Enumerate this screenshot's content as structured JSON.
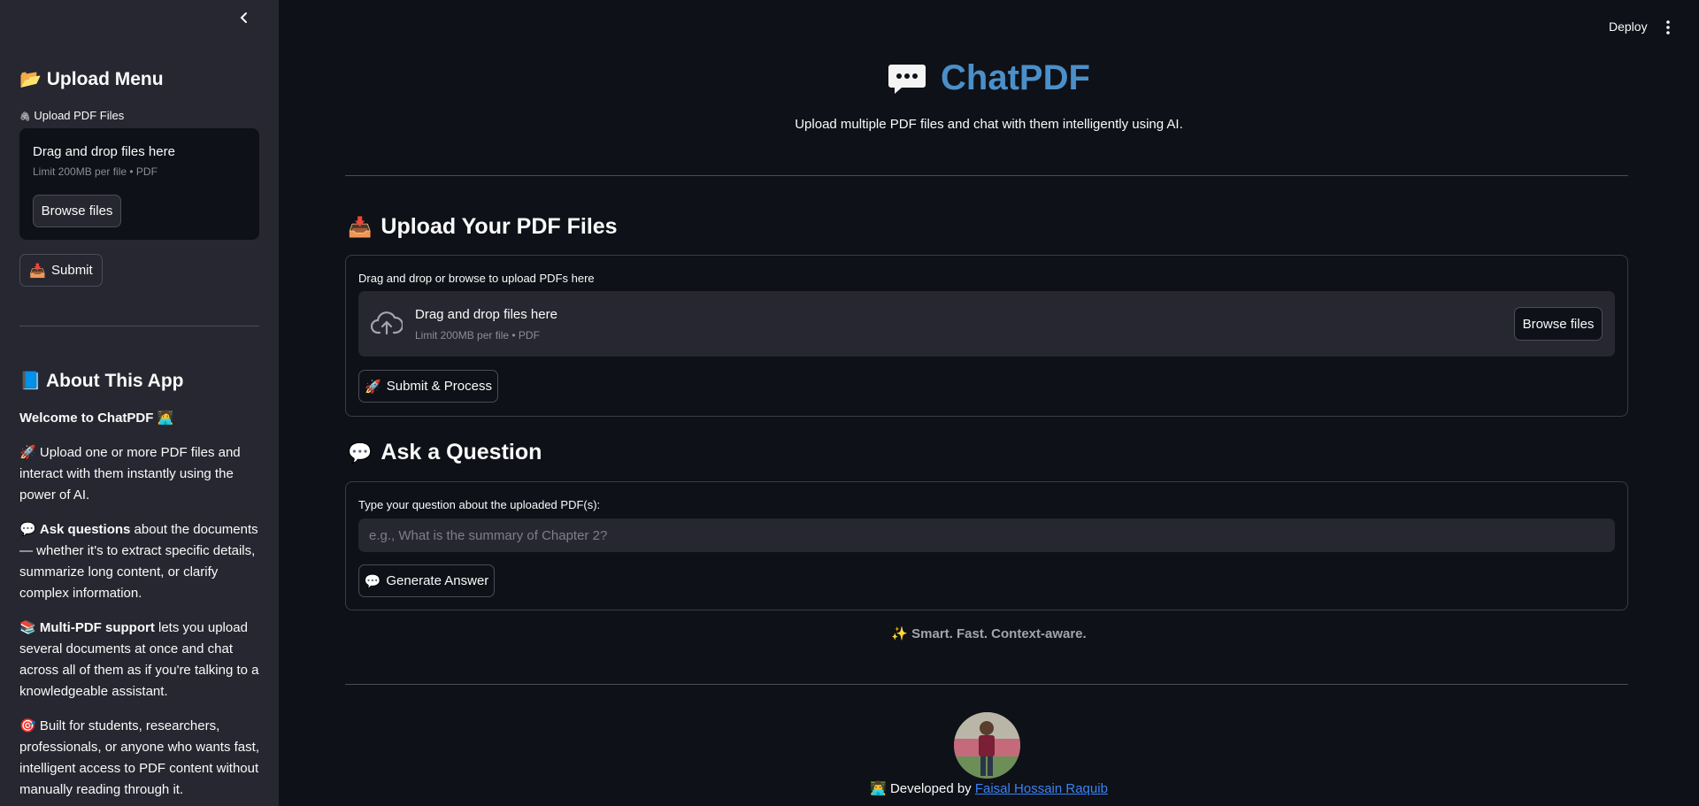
{
  "topbar": {
    "deploy_label": "Deploy"
  },
  "sidebar": {
    "upload_menu_title": "Upload Menu",
    "upload_label": "Upload PDF Files",
    "drop_text": "Drag and drop files here",
    "drop_limit": "Limit 200MB per file • PDF",
    "browse_label": "Browse files",
    "submit_label": "Submit",
    "about_title": "About This App",
    "welcome": "Welcome to ChatPDF",
    "para1": "Upload one or more PDF files and interact with them instantly using the power of AI.",
    "para2_bold": "Ask questions",
    "para2_rest": " about the documents — whether it's to extract specific details, summarize long content, or clarify complex information.",
    "para3_bold": "Multi-PDF support",
    "para3_rest": " lets you upload several documents at once and chat across all of them as if you're talking to a knowledgeable assistant.",
    "para4": "Built for students, researchers, professionals, or anyone who wants fast, intelligent access to PDF content without manually reading through it."
  },
  "header": {
    "title": "ChatPDF",
    "subtitle": "Upload multiple PDF files and chat with them intelligently using AI."
  },
  "upload_section": {
    "title": "Upload Your PDF Files",
    "label": "Drag and drop or browse to upload PDFs here",
    "drop_text": "Drag and drop files here",
    "drop_limit": "Limit 200MB per file • PDF",
    "browse_label": "Browse files",
    "submit_label": "Submit & Process"
  },
  "question_section": {
    "title": "Ask a Question",
    "label": "Type your question about the uploaded PDF(s):",
    "placeholder": "e.g., What is the summary of Chapter 2?",
    "button_label": "Generate Answer"
  },
  "footer": {
    "tagline": "Smart. Fast. Context-aware.",
    "developed_by": "Developed by",
    "author": "Faisal Hossain Raquib"
  }
}
